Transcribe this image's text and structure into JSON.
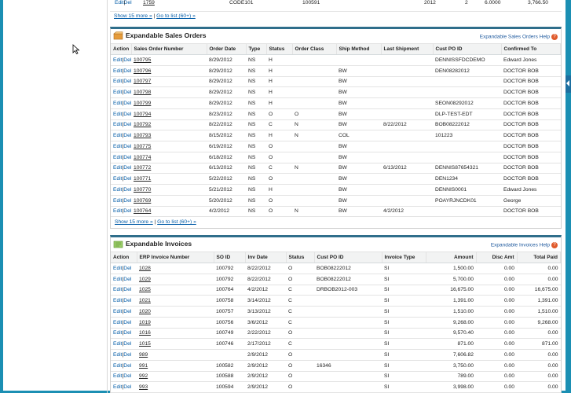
{
  "top_strip": {
    "row": {
      "actions": [
        "Edit",
        "Del"
      ],
      "number": "1759",
      "code": "CODE101",
      "id": "100591",
      "year": "2012",
      "qty": "2",
      "rate": "6.0000",
      "total": "3,766.50"
    },
    "show_more": "Show 15 more »",
    "go_to_list": "Go to list (60+) »"
  },
  "sales_orders": {
    "title": "Expandable Sales Orders",
    "help": "Expandable Sales Orders Help",
    "columns": [
      "Action",
      "Sales Order Number",
      "Order Date",
      "Type",
      "Status",
      "Order Class",
      "Ship Method",
      "Last Shipment",
      "Cust PO ID",
      "Confirmed To"
    ],
    "rows": [
      {
        "num": "100795",
        "date": "8/29/2012",
        "type": "NS",
        "status": "H",
        "cls": "",
        "ship": "",
        "last": "",
        "po": "DENNISSFDCDEMO",
        "conf": "Edward Jones"
      },
      {
        "num": "100796",
        "date": "8/29/2012",
        "type": "NS",
        "status": "H",
        "cls": "",
        "ship": "BW",
        "last": "",
        "po": "DEN08282012",
        "conf": "DOCTOR BOB"
      },
      {
        "num": "100797",
        "date": "8/29/2012",
        "type": "NS",
        "status": "H",
        "cls": "",
        "ship": "BW",
        "last": "",
        "po": "",
        "conf": "DOCTOR BOB"
      },
      {
        "num": "100798",
        "date": "8/29/2012",
        "type": "NS",
        "status": "H",
        "cls": "",
        "ship": "BW",
        "last": "",
        "po": "",
        "conf": "DOCTOR BOB"
      },
      {
        "num": "100799",
        "date": "8/29/2012",
        "type": "NS",
        "status": "H",
        "cls": "",
        "ship": "BW",
        "last": "",
        "po": "SEON08292012",
        "conf": "DOCTOR BOB"
      },
      {
        "num": "100794",
        "date": "8/23/2012",
        "type": "NS",
        "status": "O",
        "cls": "O",
        "ship": "BW",
        "last": "",
        "po": "DLP-TEST-EDT",
        "conf": "DOCTOR BOB"
      },
      {
        "num": "100792",
        "date": "8/22/2012",
        "type": "NS",
        "status": "C",
        "cls": "N",
        "ship": "BW",
        "last": "8/22/2012",
        "po": "BOB08222012",
        "conf": "DOCTOR BOB"
      },
      {
        "num": "100793",
        "date": "8/15/2012",
        "type": "NS",
        "status": "H",
        "cls": "N",
        "ship": "COL",
        "last": "",
        "po": "101223",
        "conf": "DOCTOR BOB"
      },
      {
        "num": "100775",
        "date": "6/19/2012",
        "type": "NS",
        "status": "O",
        "cls": "",
        "ship": "BW",
        "last": "",
        "po": "",
        "conf": "DOCTOR BOB"
      },
      {
        "num": "100774",
        "date": "6/18/2012",
        "type": "NS",
        "status": "O",
        "cls": "",
        "ship": "BW",
        "last": "",
        "po": "",
        "conf": "DOCTOR BOB"
      },
      {
        "num": "100772",
        "date": "6/13/2012",
        "type": "NS",
        "status": "C",
        "cls": "N",
        "ship": "BW",
        "last": "6/13/2012",
        "po": "DENNIS87654321",
        "conf": "DOCTOR BOB"
      },
      {
        "num": "100771",
        "date": "5/22/2012",
        "type": "NS",
        "status": "O",
        "cls": "",
        "ship": "BW",
        "last": "",
        "po": "DEN1234",
        "conf": "DOCTOR BOB"
      },
      {
        "num": "100770",
        "date": "5/21/2012",
        "type": "NS",
        "status": "H",
        "cls": "",
        "ship": "BW",
        "last": "",
        "po": "DENNIS0001",
        "conf": "Edward Jones"
      },
      {
        "num": "100769",
        "date": "5/20/2012",
        "type": "NS",
        "status": "O",
        "cls": "",
        "ship": "BW",
        "last": "",
        "po": "POAYRJNCDK01",
        "conf": "George"
      },
      {
        "num": "100764",
        "date": "4/2/2012",
        "type": "NS",
        "status": "O",
        "cls": "N",
        "ship": "BW",
        "last": "4/2/2012",
        "po": "",
        "conf": "DOCTOR BOB"
      }
    ],
    "show_more": "Show 15 more »",
    "go_to_list": "Go to list (60+) »"
  },
  "invoices": {
    "title": "Expandable Invoices",
    "help": "Expandable Invoices Help",
    "columns": [
      "Action",
      "ERP Invoice Number",
      "SO ID",
      "Inv Date",
      "Status",
      "Cust PO ID",
      "Invoice Type",
      "Amount",
      "Disc Amt",
      "Total Paid"
    ],
    "rows": [
      {
        "num": "1028",
        "so": "100792",
        "date": "8/22/2012",
        "status": "O",
        "po": "BOB08222012",
        "type": "SI",
        "amount": "1,500.00",
        "disc": "0.00",
        "paid": "0.00"
      },
      {
        "num": "1029",
        "so": "100792",
        "date": "8/22/2012",
        "status": "O",
        "po": "BOB08222012",
        "type": "SI",
        "amount": "5,700.00",
        "disc": "0.00",
        "paid": "0.00"
      },
      {
        "num": "1025",
        "so": "100764",
        "date": "4/2/2012",
        "status": "C",
        "po": "DRBOB2012-003",
        "type": "SI",
        "amount": "16,675.00",
        "disc": "0.00",
        "paid": "16,675.00"
      },
      {
        "num": "1021",
        "so": "100758",
        "date": "3/14/2012",
        "status": "C",
        "po": "",
        "type": "SI",
        "amount": "1,391.00",
        "disc": "0.00",
        "paid": "1,391.00"
      },
      {
        "num": "1020",
        "so": "100757",
        "date": "3/13/2012",
        "status": "C",
        "po": "",
        "type": "SI",
        "amount": "1,510.00",
        "disc": "0.00",
        "paid": "1,510.00"
      },
      {
        "num": "1019",
        "so": "100756",
        "date": "3/6/2012",
        "status": "C",
        "po": "",
        "type": "SI",
        "amount": "9,268.00",
        "disc": "0.00",
        "paid": "9,268.00"
      },
      {
        "num": "1016",
        "so": "100749",
        "date": "2/22/2012",
        "status": "O",
        "po": "",
        "type": "SI",
        "amount": "9,570.40",
        "disc": "0.00",
        "paid": "0.00"
      },
      {
        "num": "1015",
        "so": "100746",
        "date": "2/17/2012",
        "status": "C",
        "po": "",
        "type": "SI",
        "amount": "871.00",
        "disc": "0.00",
        "paid": "871.00"
      },
      {
        "num": "989",
        "so": "",
        "date": "2/9/2012",
        "status": "O",
        "po": "",
        "type": "SI",
        "amount": "7,606.82",
        "disc": "0.00",
        "paid": "0.00"
      },
      {
        "num": "991",
        "so": "100582",
        "date": "2/9/2012",
        "status": "O",
        "po": "16346",
        "type": "SI",
        "amount": "3,750.00",
        "disc": "0.00",
        "paid": "0.00"
      },
      {
        "num": "992",
        "so": "100588",
        "date": "2/9/2012",
        "status": "O",
        "po": "",
        "type": "SI",
        "amount": "789.00",
        "disc": "0.00",
        "paid": "0.00"
      },
      {
        "num": "993",
        "so": "100594",
        "date": "2/9/2012",
        "status": "O",
        "po": "",
        "type": "SI",
        "amount": "3,998.00",
        "disc": "0.00",
        "paid": "0.00"
      }
    ]
  },
  "labels": {
    "edit": "Edit",
    "del": "Del",
    "pipe": "|"
  },
  "colors": {
    "frame": "#1b8fb3",
    "block_border_top": "#2f6e8b",
    "link": "#015ba7",
    "header_bg": "#f2f3f3"
  }
}
